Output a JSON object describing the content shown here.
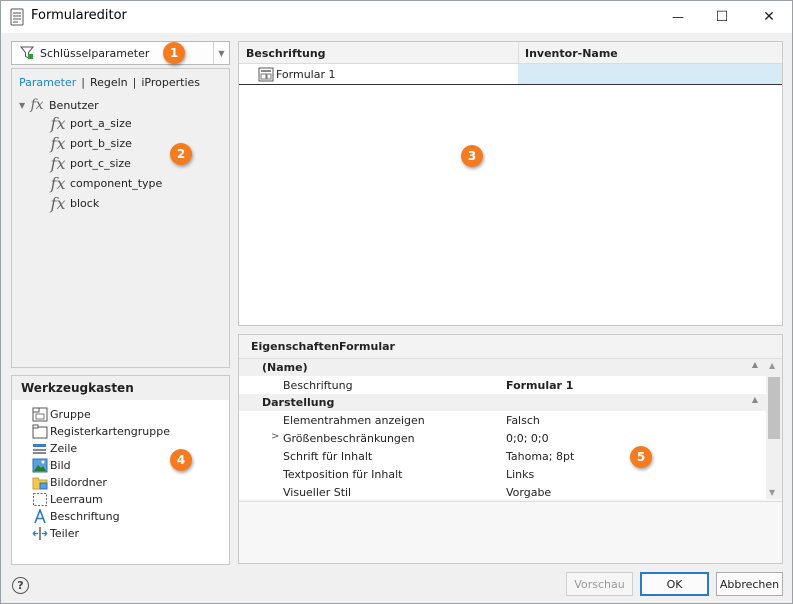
{
  "window": {
    "title": "Formulareditor"
  },
  "titlebar": {
    "minimize_glyph": "—",
    "maximize_glyph": "☐",
    "close_glyph": "✕"
  },
  "filter": {
    "label": "Schlüsselparameter",
    "icon": "filter-icon"
  },
  "tree": {
    "tabs": [
      "Parameter",
      "Regeln",
      "iProperties"
    ],
    "separator": "|",
    "fx_glyph": "fx",
    "root": "Benutzer",
    "items": [
      "port_a_size",
      "port_b_size",
      "port_c_size",
      "component_type",
      "block"
    ]
  },
  "toolbox": {
    "title": "Werkzeugkasten",
    "items": [
      {
        "label": "Gruppe",
        "icon": "group-icon"
      },
      {
        "label": "Registerkartengruppe",
        "icon": "tab-group-icon"
      },
      {
        "label": "Zeile",
        "icon": "row-icon"
      },
      {
        "label": "Bild",
        "icon": "image-icon"
      },
      {
        "label": "Bildordner",
        "icon": "image-folder-icon"
      },
      {
        "label": "Leerraum",
        "icon": "spacer-icon"
      },
      {
        "label": "Beschriftung",
        "icon": "label-icon"
      },
      {
        "label": "Teiler",
        "icon": "splitter-icon"
      }
    ]
  },
  "grid": {
    "columns": [
      "Beschriftung",
      "Inventor-Name"
    ],
    "rows": [
      {
        "beschriftung": "Formular 1",
        "inventor_name": ""
      }
    ]
  },
  "props": {
    "header_left": "Eigenschaften",
    "header_right": "Formular",
    "categories": [
      {
        "name": "(Name)",
        "rows": [
          {
            "name": "Beschriftung",
            "value": "Formular 1",
            "bold": true
          }
        ]
      },
      {
        "name": "Darstellung",
        "rows": [
          {
            "name": "Elementrahmen anzeigen",
            "value": "Falsch"
          },
          {
            "name": "Größenbeschränkungen",
            "value": "0;0; 0;0",
            "expandable": true
          },
          {
            "name": "Schrift für Inhalt",
            "value": "Tahoma; 8pt"
          },
          {
            "name": "Textposition für Inhalt",
            "value": "Links"
          },
          {
            "name": "Visueller Stil",
            "value": "Vorgabe"
          }
        ]
      }
    ]
  },
  "callouts": [
    "1",
    "2",
    "3",
    "4",
    "5"
  ],
  "footer": {
    "help": "?",
    "preview": "Vorschau",
    "ok": "OK",
    "cancel": "Abbrechen"
  },
  "colors": {
    "accent": "#1a86c7",
    "callout": "#f47b20",
    "selection": "#d7ebf7"
  }
}
